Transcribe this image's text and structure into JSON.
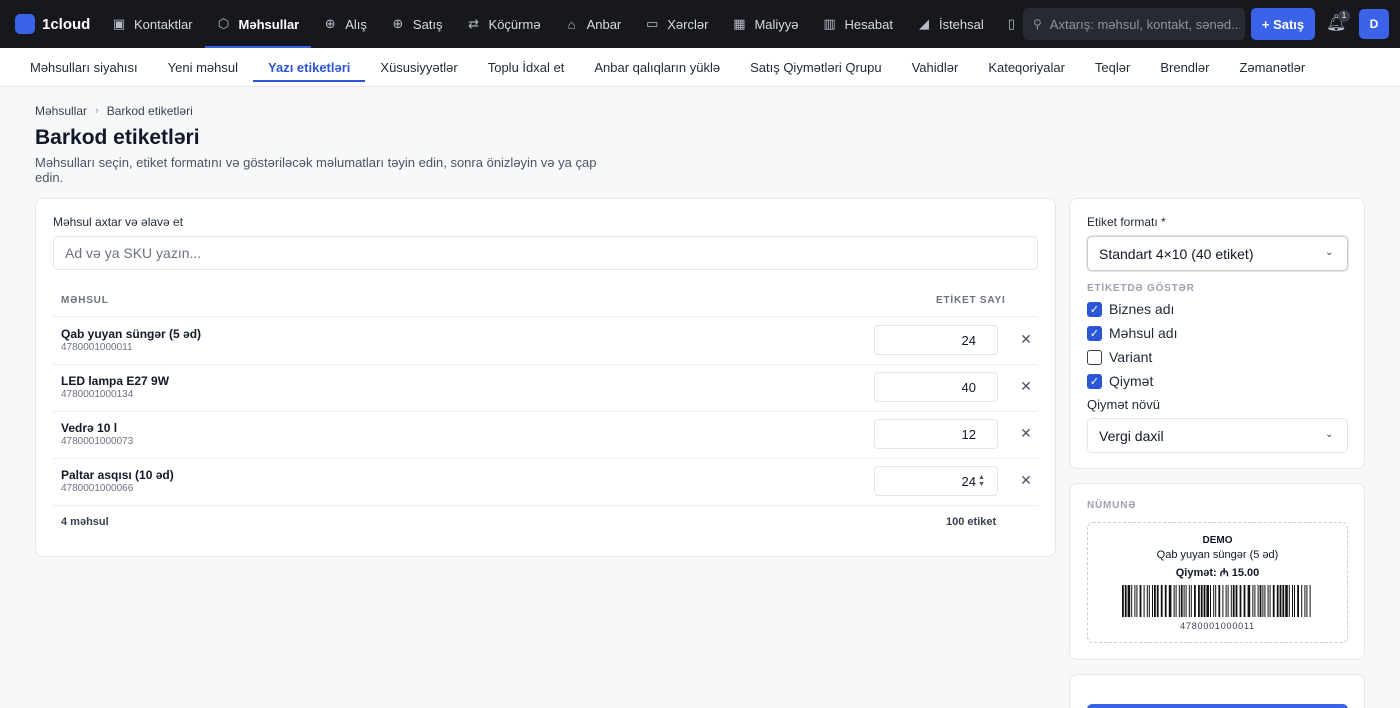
{
  "topbar": {
    "brand": "1cloud",
    "nav": [
      {
        "label": "Kontaktlar",
        "icon": "contacts-icon",
        "glyph": "▣"
      },
      {
        "label": "Məhsullar",
        "icon": "box-icon",
        "glyph": "⬡"
      },
      {
        "label": "Alış",
        "icon": "purchase-icon",
        "glyph": "⊕"
      },
      {
        "label": "Satış",
        "icon": "sale-icon",
        "glyph": "⊕"
      },
      {
        "label": "Köçürmə",
        "icon": "transfer-icon",
        "glyph": "⇄"
      },
      {
        "label": "Anbar",
        "icon": "warehouse-icon",
        "glyph": "⌂"
      },
      {
        "label": "Xərclər",
        "icon": "expense-icon",
        "glyph": "▭"
      },
      {
        "label": "Maliyyə",
        "icon": "finance-icon",
        "glyph": "▦"
      },
      {
        "label": "Hesabat",
        "icon": "report-icon",
        "glyph": "▥"
      },
      {
        "label": "İstehsal",
        "icon": "production-icon",
        "glyph": "◢"
      }
    ],
    "active_nav": "Məhsullar",
    "search_placeholder": "Axtarış: məhsul, kontakt, sənəd...",
    "sale_button": "+ Satış",
    "notification_count": "1",
    "avatar_initial": "D"
  },
  "subnav": {
    "items": [
      "Məhsulları siyahısı",
      "Yeni məhsul",
      "Yazı etiketləri",
      "Xüsusiyyətlər",
      "Toplu İdxal et",
      "Anbar qalıqların yüklə",
      "Satış Qiymətləri Qrupu",
      "Vahidlər",
      "Kateqoriyalar",
      "Teqlər",
      "Brendlər",
      "Zəmanətlər"
    ],
    "active": "Yazı etiketləri"
  },
  "page": {
    "breadcrumb": [
      "Məhsullar",
      "Barkod etiketləri"
    ],
    "title": "Barkod etiketləri",
    "subtitle": "Məhsulları seçin, etiket formatını və göstəriləcək məlumatları təyin edin, sonra önizləyin və ya çap edin."
  },
  "products_card": {
    "label": "Məhsul axtar və əlavə et",
    "placeholder": "Ad və ya SKU yazın...",
    "col_product": "MƏHSUL",
    "col_count": "ETİKET SAYI",
    "rows": [
      {
        "name": "Qab yuyan süngər (5 əd)",
        "sku": "4780001000011",
        "qty": "24"
      },
      {
        "name": "LED lampa E27 9W",
        "sku": "4780001000134",
        "qty": "40"
      },
      {
        "name": "Vedrə 10 l",
        "sku": "4780001000073",
        "qty": "12"
      },
      {
        "name": "Paltar asqısı (10 əd)",
        "sku": "4780001000066",
        "qty": "24"
      }
    ],
    "footer_count": "4 məhsul",
    "footer_total": "100 etiket"
  },
  "format_card": {
    "format_label": "Etiket formatı *",
    "format_value": "Standart 4×10 (40 etiket)",
    "show_caption": "ETİKETDƏ GÖSTƏR",
    "options": [
      {
        "label": "Biznes adı",
        "checked": true
      },
      {
        "label": "Məhsul adı",
        "checked": true
      },
      {
        "label": "Variant",
        "checked": false
      },
      {
        "label": "Qiymət",
        "checked": true
      }
    ],
    "price_type_label": "Qiymət növü",
    "price_type_value": "Vergi daxil"
  },
  "preview_card": {
    "caption": "NÜMUNƏ",
    "company": "DEMO",
    "product": "Qab yuyan süngər (5 əd)",
    "price": "Qiymət: ₼ 15.00",
    "barcode": "4780001000011"
  },
  "colors": {
    "accent": "#3b63e8",
    "topbar_bg": "#16181d",
    "active_tab": "#2c56d6"
  }
}
